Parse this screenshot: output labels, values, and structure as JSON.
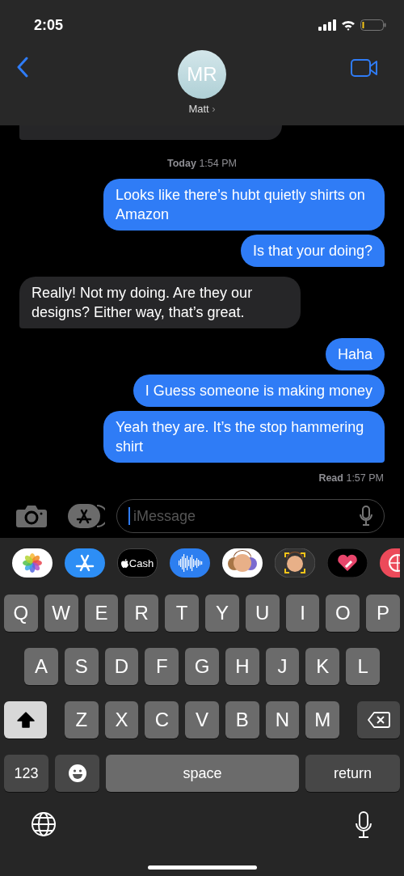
{
  "status_bar": {
    "time": "2:05"
  },
  "contact": {
    "initials": "MR",
    "name": "Matt",
    "chevron": "›"
  },
  "messages": [
    {
      "kind": "fragment"
    },
    {
      "kind": "timestamp",
      "day": "Today",
      "time": "1:54 PM"
    },
    {
      "kind": "sent",
      "text": "Looks like there’s hubt quietly shirts on Amazon",
      "tail": false
    },
    {
      "kind": "sent",
      "text": "Is that your doing?",
      "tail": true
    },
    {
      "kind": "received",
      "text": "Really!  Not my doing.  Are they our designs?  Either way, that’s great.",
      "tail": true
    },
    {
      "kind": "sent",
      "text": "Haha",
      "tail": false
    },
    {
      "kind": "sent",
      "text": "I Guess someone is making money",
      "tail": false
    },
    {
      "kind": "sent",
      "text": "Yeah they are. It’s the stop hammering shirt",
      "tail": true
    },
    {
      "kind": "receipt",
      "status": "Read",
      "time": "1:57 PM"
    }
  ],
  "compose": {
    "placeholder": "iMessage"
  },
  "app_strip": [
    {
      "kind": "photos"
    },
    {
      "kind": "appstore"
    },
    {
      "kind": "cash",
      "label": "Cash"
    },
    {
      "kind": "audio"
    },
    {
      "kind": "memoji"
    },
    {
      "kind": "memoji-frame"
    },
    {
      "kind": "heart"
    },
    {
      "kind": "globe-red"
    }
  ],
  "keyboard": {
    "shift_on": true,
    "rows": [
      [
        "Q",
        "W",
        "E",
        "R",
        "T",
        "Y",
        "U",
        "I",
        "O",
        "P"
      ],
      [
        "A",
        "S",
        "D",
        "F",
        "G",
        "H",
        "J",
        "K",
        "L"
      ],
      [
        "Z",
        "X",
        "C",
        "V",
        "B",
        "N",
        "M"
      ]
    ],
    "numbers": "123",
    "space": "space",
    "return": "return"
  }
}
